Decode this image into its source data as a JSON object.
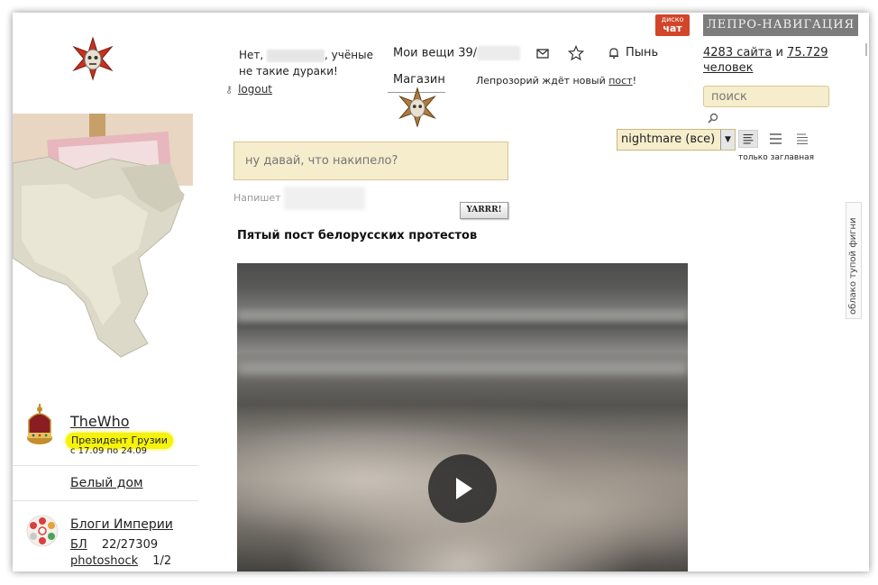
{
  "header": {
    "disco_chat_line1": "диско",
    "disco_chat_line2": "чат",
    "lepro_nav": "ЛЕПРО-НАВИГАЦИЯ",
    "greeting_start": "Нет,",
    "greeting_end": ", учёные не такие дураки!",
    "logout": "logout",
    "my_items": "Мои вещи 39/",
    "notifications": "Пынь",
    "shop": "Магазин",
    "leprosory_text": "Лепрозорий ждёт новый ",
    "leprosory_link": "пост",
    "leprosory_end": "!",
    "stats_sites": "4283 сайта",
    "stats_and": " и ",
    "stats_people_num": "75.729",
    "stats_people": "человек",
    "search_placeholder": "поиск"
  },
  "filters": {
    "selected": "nightmare (все)",
    "view_caption": "только заглавная"
  },
  "composer": {
    "placeholder": "ну давай, что накипело?",
    "author_label": "Напишет",
    "submit": "YARRR!"
  },
  "post": {
    "title": "Пятый пост белорусских протестов"
  },
  "sidebar": {
    "username": "TheWho",
    "title_badge": "Президент Грузии",
    "term": "с 17.09 по 24.09",
    "white_house": "Белый дом",
    "blogs_link": "Блоги Империи",
    "blogs": [
      {
        "name": "БЛ",
        "count": "22/27309"
      },
      {
        "name": "photoshock",
        "count": "1/2"
      }
    ]
  },
  "side_tab": "облако тупой фигни",
  "colors": {
    "accent_input": "#f6edcd",
    "badge_yellow": "#f6f20c",
    "disco_red": "#d1452a",
    "nav_gray": "#7c7c7c"
  }
}
